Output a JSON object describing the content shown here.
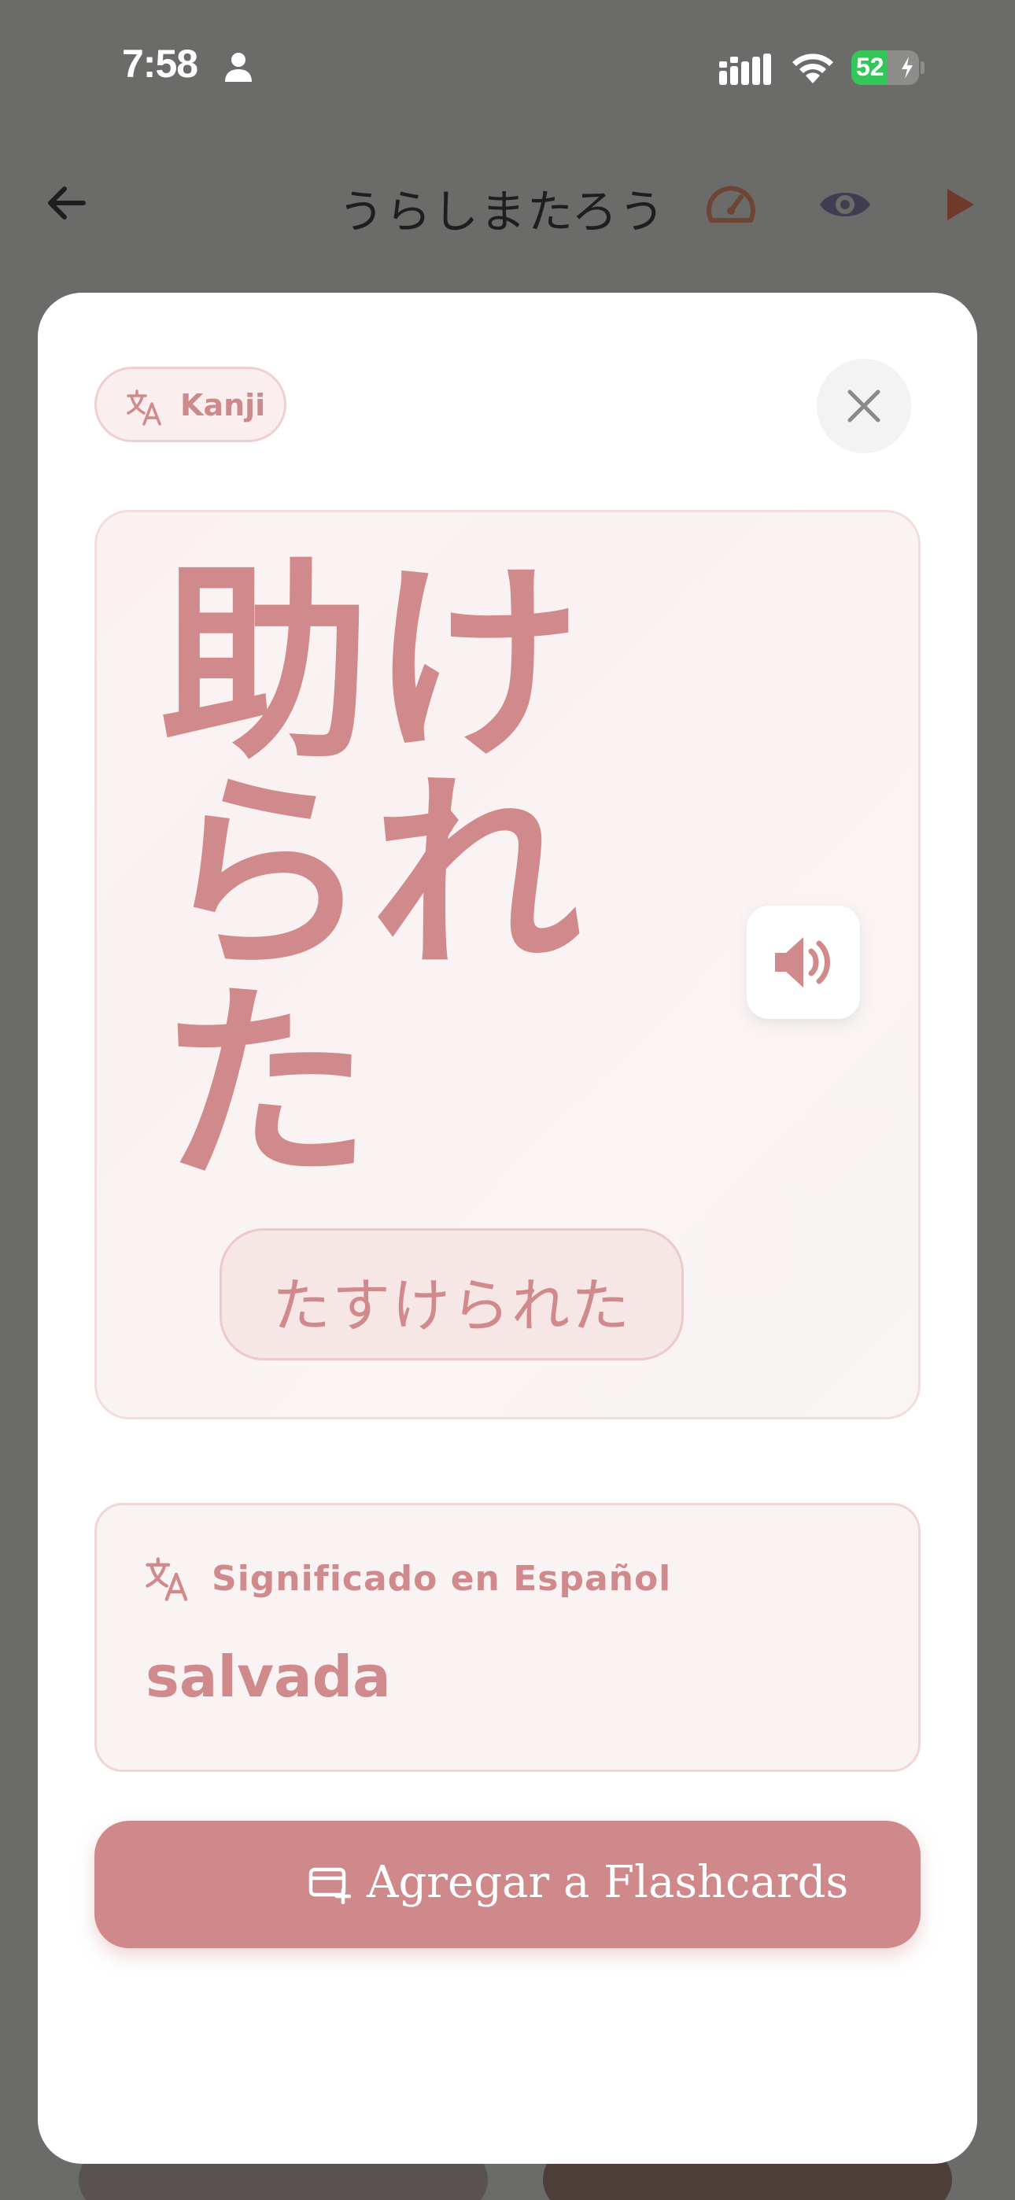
{
  "status_bar": {
    "time": "7:58",
    "battery_level": "52",
    "battery_fraction": 0.52
  },
  "header": {
    "title": "うらしまたろう",
    "icons": [
      "back-arrow-icon",
      "speedometer-icon",
      "eye-icon",
      "play-icon"
    ]
  },
  "modal": {
    "badge_label": "Kanji",
    "word": "助けられた",
    "reading": "たすけられた",
    "meaning_label": "Significado en Español",
    "meaning": "salvada",
    "add_button_label": "Agregar a Flashcards"
  },
  "colors": {
    "accent": "#cf898b",
    "overlay": "#6b6b69",
    "battery_green": "#33c759"
  }
}
